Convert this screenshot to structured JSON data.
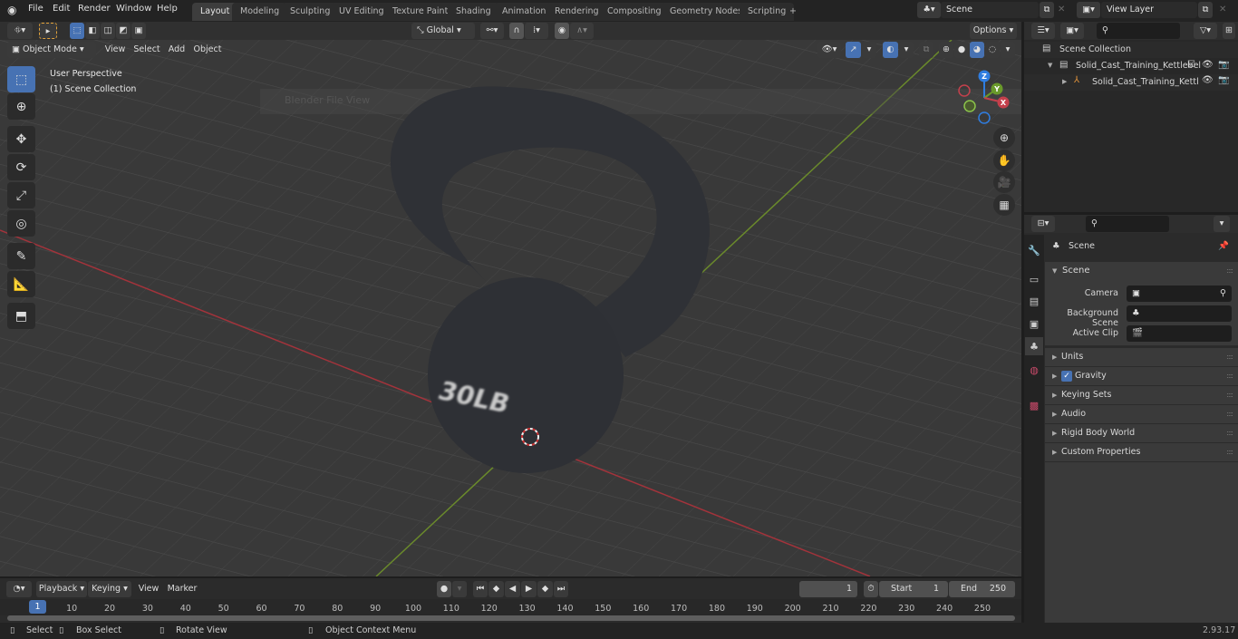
{
  "topbar": {
    "menu": [
      "File",
      "Edit",
      "Render",
      "Window",
      "Help"
    ],
    "workspaces": [
      "Layout",
      "Modeling",
      "Sculpting",
      "UV Editing",
      "Texture Paint",
      "Shading",
      "Animation",
      "Rendering",
      "Compositing",
      "Geometry Nodes",
      "Scripting"
    ],
    "active_workspace": "Layout",
    "add_tab": "+",
    "scene_name": "Scene",
    "view_layer": "View Layer"
  },
  "viewport": {
    "mode": "Object Mode",
    "menus": [
      "View",
      "Select",
      "Add",
      "Object"
    ],
    "orientation": "Global",
    "options_label": "Options",
    "overlay_line1": "User Perspective",
    "overlay_line2": "(1) Scene Collection",
    "gizmo_axes": {
      "x": "X",
      "y": "Y",
      "z": "Z"
    },
    "object_text": "30LB",
    "colors": {
      "accent": "#4772b3",
      "x_axis": "#c4404c",
      "y_axis": "#6a9a2b",
      "z_axis": "#2f7de0"
    },
    "bg_dialog_title": "Blender File View"
  },
  "outliner": {
    "root": "Scene Collection",
    "items": [
      {
        "name": "Solid_Cast_Training_Kettlebel",
        "type": "collection"
      },
      {
        "name": "Solid_Cast_Training_Kettl",
        "type": "object"
      }
    ]
  },
  "properties": {
    "context": "Scene",
    "section": "Scene",
    "fields": [
      {
        "label": "Camera",
        "value": ""
      },
      {
        "label": "Background Scene",
        "value": ""
      },
      {
        "label": "Active Clip",
        "value": ""
      }
    ],
    "panels": [
      "Units",
      "Gravity",
      "Keying Sets",
      "Audio",
      "Rigid Body World",
      "Custom Properties"
    ],
    "gravity_checked": true
  },
  "timeline": {
    "menus": [
      "Playback",
      "Keying",
      "View",
      "Marker"
    ],
    "current_frame": "1",
    "start_label": "Start",
    "start": "1",
    "end_label": "End",
    "end": "250",
    "ticks": [
      "10",
      "20",
      "30",
      "40",
      "50",
      "60",
      "70",
      "80",
      "90",
      "100",
      "110",
      "120",
      "130",
      "140",
      "150",
      "160",
      "170",
      "180",
      "190",
      "200",
      "210",
      "220",
      "230",
      "240",
      "250"
    ],
    "playhead": "1"
  },
  "statusbar": {
    "select": "Select",
    "box_select": "Box Select",
    "rotate": "Rotate View",
    "context_menu": "Object Context Menu",
    "version": "2.93.17"
  }
}
